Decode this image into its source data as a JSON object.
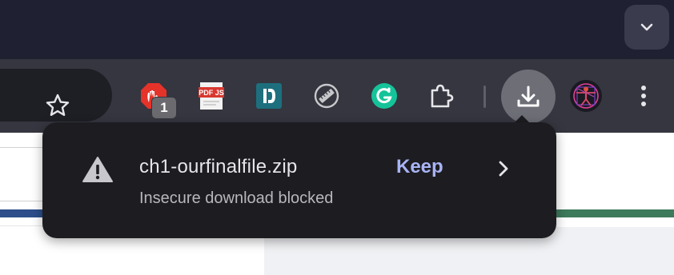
{
  "tab_strip": {
    "tab_search_icon": "chevron-down-icon"
  },
  "toolbar": {
    "bookmark_icon": "star-icon",
    "extensions": [
      {
        "name": "adblock-icon",
        "badge": "1",
        "color": "#e5332a"
      },
      {
        "name": "pdfjs-icon",
        "label": "PDF JS",
        "color": "#d8382f"
      },
      {
        "name": "dashlane-icon",
        "color": "#1d6f7e"
      },
      {
        "name": "ruler-icon",
        "color": "#c8c8cc"
      },
      {
        "name": "grammarly-icon",
        "color": "#15c39a"
      },
      {
        "name": "puzzle-icon",
        "color": "#e6e6ea"
      }
    ],
    "download_icon": "download-icon",
    "profile_icon": "vitruvian-avatar-icon",
    "menu_icon": "kebab-menu-icon"
  },
  "download_bubble": {
    "icon": "warning-icon",
    "filename": "ch1-ourfinalfile.zip",
    "status": "Insecure download blocked",
    "keep_label": "Keep",
    "more_icon": "chevron-right-icon",
    "accent_color": "#a9b4f5"
  }
}
